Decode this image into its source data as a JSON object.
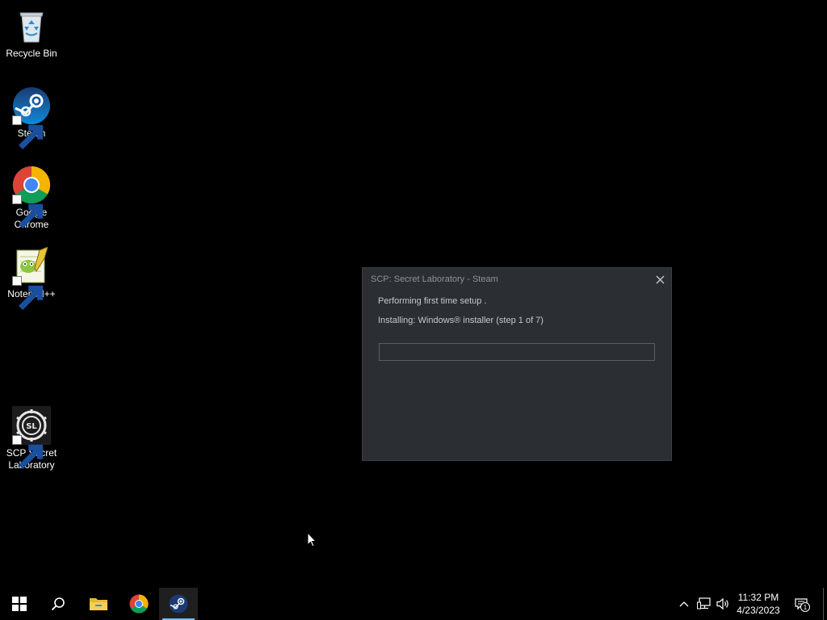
{
  "desktop": {
    "icons": [
      {
        "label": "Recycle Bin",
        "icon": "recycle-bin-icon"
      },
      {
        "label": "Steam",
        "icon": "steam-icon"
      },
      {
        "label": "Google Chrome",
        "icon": "chrome-icon"
      },
      {
        "label": "Notepad++",
        "icon": "notepad-plus-plus-icon"
      },
      {
        "label": "SCP Secret Laboratory",
        "icon": "scp-sl-icon"
      }
    ]
  },
  "dialog": {
    "title": "SCP: Secret Laboratory - Steam",
    "setup_text": "Performing first time setup .",
    "install_text": "Installing: Windows® installer (step 1 of 7)",
    "progress_fraction": 0,
    "close_icon": "close-icon"
  },
  "taskbar": {
    "items": [
      {
        "name": "start",
        "icon": "windows-logo-icon"
      },
      {
        "name": "search",
        "icon": "search-icon"
      },
      {
        "name": "file-explorer",
        "icon": "folder-icon"
      },
      {
        "name": "chrome",
        "icon": "chrome-icon"
      },
      {
        "name": "steam",
        "icon": "steam-icon",
        "active": true
      }
    ],
    "tray": {
      "time": "11:32 PM",
      "date": "4/23/2023",
      "notification_count": "1"
    }
  },
  "colors": {
    "desktop_bg": "#000000",
    "dialog_bg": "#2b2f33",
    "dialog_text": "#c5c9cd",
    "dialog_title_text": "#8c9299",
    "taskbar_accent": "#76b9ed",
    "steam_blue": "#1a9fff"
  }
}
